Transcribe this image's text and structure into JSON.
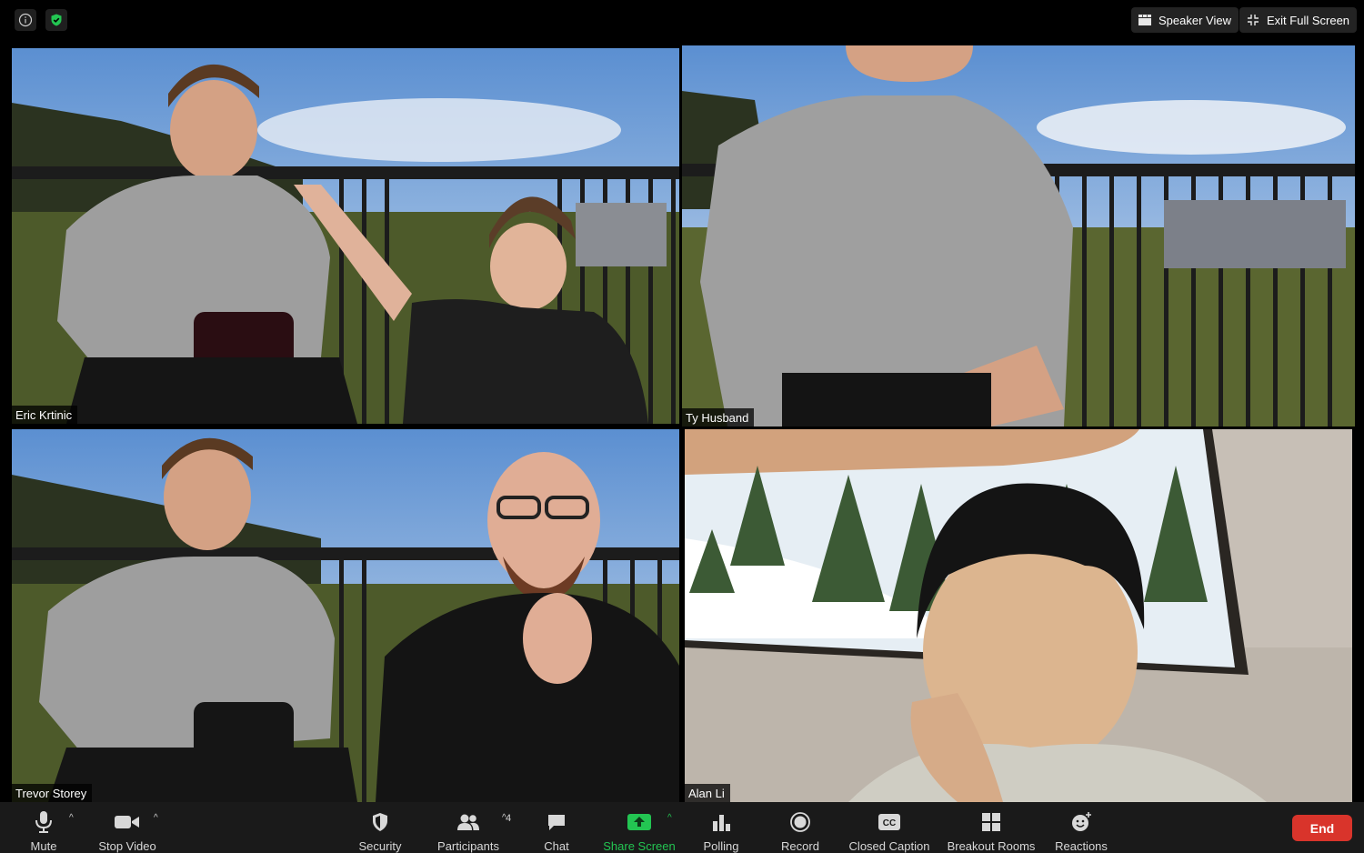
{
  "topbar": {
    "speaker_view": "Speaker View",
    "exit_full_screen": "Exit Full Screen",
    "info_icon": "info-icon",
    "security_icon": "shield-check-icon"
  },
  "participants": [
    {
      "name": "Eric Krtinic",
      "active": false
    },
    {
      "name": "Ty Husband",
      "active": true
    },
    {
      "name": "Trevor Storey",
      "active": false
    },
    {
      "name": "Alan Li",
      "active": false
    }
  ],
  "toolbar": {
    "mute": "Mute",
    "stop_video": "Stop Video",
    "security": "Security",
    "participants": "Participants",
    "participants_count": "4",
    "chat": "Chat",
    "share_screen": "Share Screen",
    "polling": "Polling",
    "record": "Record",
    "closed_caption": "Closed Caption",
    "closed_caption_icon_text": "CC",
    "breakout_rooms": "Breakout Rooms",
    "reactions": "Reactions",
    "end": "End"
  },
  "colors": {
    "active_speaker_border": "#d4eb8c",
    "share_screen": "#23c552",
    "end_button": "#d9342b",
    "toolbar_bg": "#1a1a1a"
  }
}
